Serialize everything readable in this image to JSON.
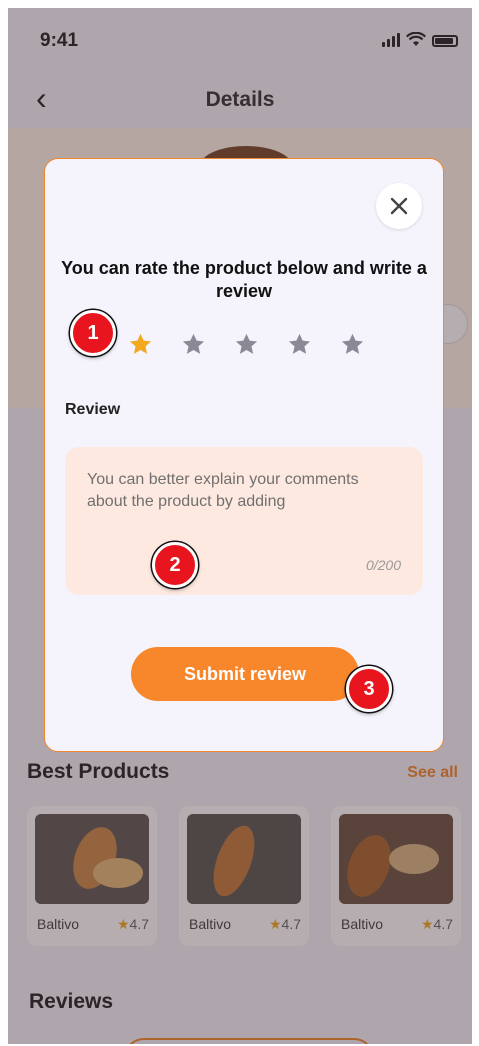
{
  "status_bar": {
    "time": "9:41"
  },
  "header": {
    "title": "Details"
  },
  "best_products": {
    "title": "Best Products",
    "see_all": "See all",
    "items": [
      {
        "name": "Baltivo",
        "rating": "4.7"
      },
      {
        "name": "Baltivo",
        "rating": "4.7"
      },
      {
        "name": "Baltivo",
        "rating": "4.7"
      }
    ]
  },
  "reviews_section": {
    "title": "Reviews"
  },
  "modal": {
    "title": "You can rate the product below and write a review",
    "rating": {
      "value": 1,
      "max": 5
    },
    "review_label": "Review",
    "review_placeholder": "You can better explain your comments about the product by adding",
    "review_counter": "0/200",
    "submit_label": "Submit review"
  },
  "markers": [
    "1",
    "2",
    "3"
  ],
  "colors": {
    "accent": "#f8862a",
    "star_active": "#f2a921",
    "star_inactive": "#8a8a96",
    "review_box": "#fde9e0",
    "marker": "#e8141e"
  }
}
